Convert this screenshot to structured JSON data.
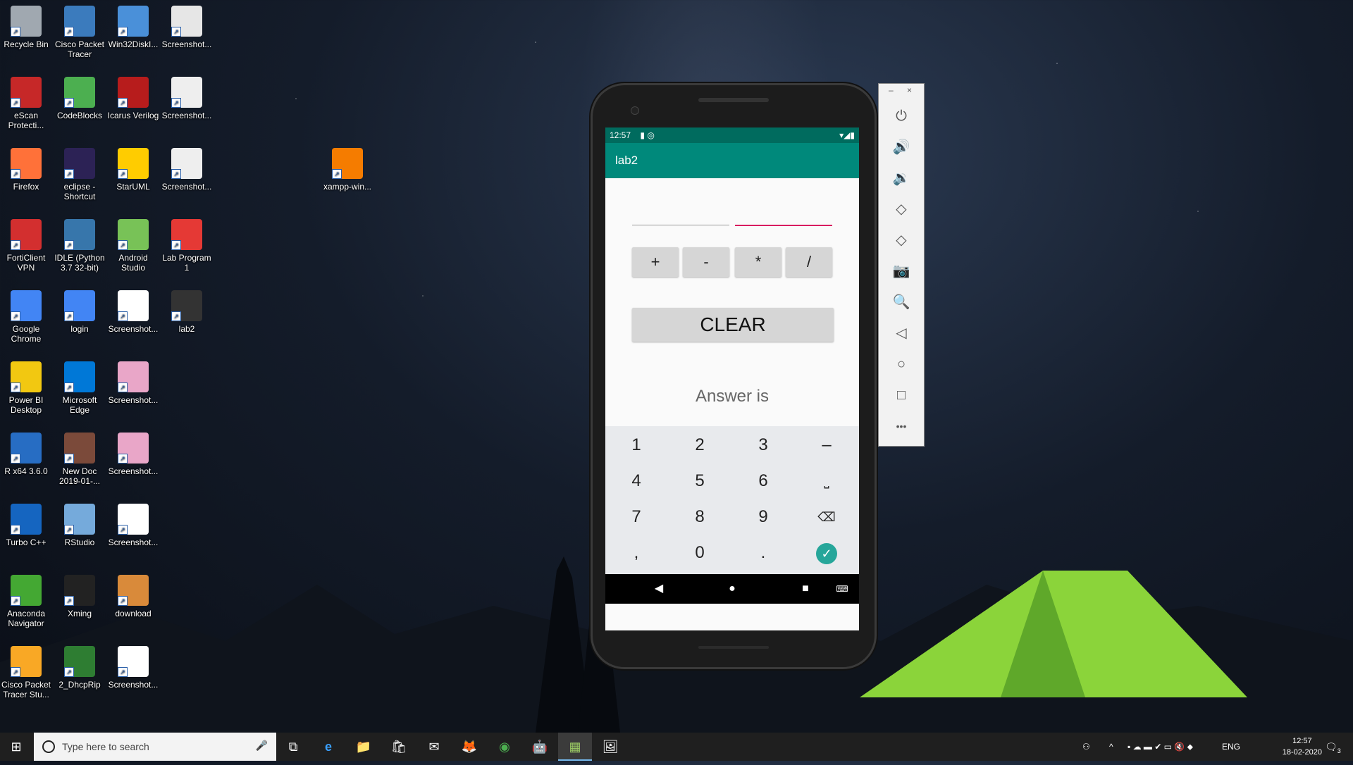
{
  "desktop": {
    "icons": [
      {
        "label": "Recycle Bin",
        "color": "#a0a8b0"
      },
      {
        "label": "Cisco Packet Tracer",
        "color": "#3b7bbd"
      },
      {
        "label": "Win32DiskI...",
        "color": "#4a90d9"
      },
      {
        "label": "Screenshot...",
        "color": "#e6e6e6"
      },
      {
        "label": "eScan Protecti...",
        "color": "#c62828"
      },
      {
        "label": "CodeBlocks",
        "color": "#4caf50"
      },
      {
        "label": "Icarus Verilog",
        "color": "#b71c1c"
      },
      {
        "label": "Screenshot...",
        "color": "#eeeeee"
      },
      {
        "label": "Firefox",
        "color": "#ff7139"
      },
      {
        "label": "eclipse - Shortcut",
        "color": "#2c2255"
      },
      {
        "label": "StarUML",
        "color": "#ffcc00"
      },
      {
        "label": "Screenshot...",
        "color": "#eeeeee"
      },
      {
        "label": "FortiClient VPN",
        "color": "#d32f2f"
      },
      {
        "label": "IDLE (Python 3.7 32-bit)",
        "color": "#3776ab"
      },
      {
        "label": "Android Studio",
        "color": "#78c257"
      },
      {
        "label": "Lab Program 1",
        "color": "#e53935"
      },
      {
        "label": "Google Chrome",
        "color": "#4285f4"
      },
      {
        "label": "login",
        "color": "#4285f4"
      },
      {
        "label": "Screenshot...",
        "color": "#ffffff"
      },
      {
        "label": "lab2",
        "color": "#333333"
      },
      {
        "label": "Power BI Desktop",
        "color": "#f2c811"
      },
      {
        "label": "Microsoft Edge",
        "color": "#0078d7"
      },
      {
        "label": "Screenshot...",
        "color": "#e9a6c8"
      },
      {
        "label": "R x64 3.6.0",
        "color": "#276dc3"
      },
      {
        "label": "New Doc 2019-01-...",
        "color": "#7b4a3a"
      },
      {
        "label": "Screenshot...",
        "color": "#e9a6c8"
      },
      {
        "label": "Turbo C++",
        "color": "#1565c0"
      },
      {
        "label": "RStudio",
        "color": "#75aadb"
      },
      {
        "label": "Screenshot...",
        "color": "#ffffff"
      },
      {
        "label": "Anaconda Navigator",
        "color": "#44a833"
      },
      {
        "label": "Xming",
        "color": "#222222"
      },
      {
        "label": "download",
        "color": "#d98a3a"
      },
      {
        "label": "Cisco Packet Tracer Stu...",
        "color": "#f9a825"
      },
      {
        "label": "2_DhcpRip",
        "color": "#2e7d32"
      },
      {
        "label": "Screenshot...",
        "color": "#ffffff"
      },
      {
        "label": "xampp-win...",
        "color": "#f57c00"
      }
    ]
  },
  "phone": {
    "status": {
      "time": "12:57",
      "icons_right": "▾◢▮"
    },
    "app_title": "lab2",
    "ops": [
      "+",
      "-",
      "*",
      "/"
    ],
    "clear_label": "CLEAR",
    "answer": "Answer is",
    "keys": [
      "1",
      "2",
      "3",
      "–",
      "4",
      "5",
      "6",
      "⎵",
      "7",
      "8",
      "9",
      "⌫",
      ",",
      "0",
      "."
    ],
    "ok_glyph": "✓",
    "nav": {
      "back": "◀",
      "home": "●",
      "recents": "■",
      "keyboard": "⌨"
    }
  },
  "emulator_toolbar": {
    "minimize": "–",
    "close": "×",
    "buttons": [
      "⏻",
      "🔊",
      "🔉",
      "◇",
      "◇",
      "📷",
      "🔍",
      "◁",
      "○",
      "□",
      "•••"
    ]
  },
  "taskbar": {
    "search_placeholder": "Type here to search",
    "mic": "🎤",
    "apps": [
      "⧉",
      "e",
      "📁",
      "🛍",
      "✉",
      "🦊",
      "◉",
      "🤖",
      "▦",
      "🖼"
    ],
    "tray_lang": "ENG",
    "clock_time": "12:57",
    "clock_date": "18-02-2020",
    "notifications": "3"
  }
}
